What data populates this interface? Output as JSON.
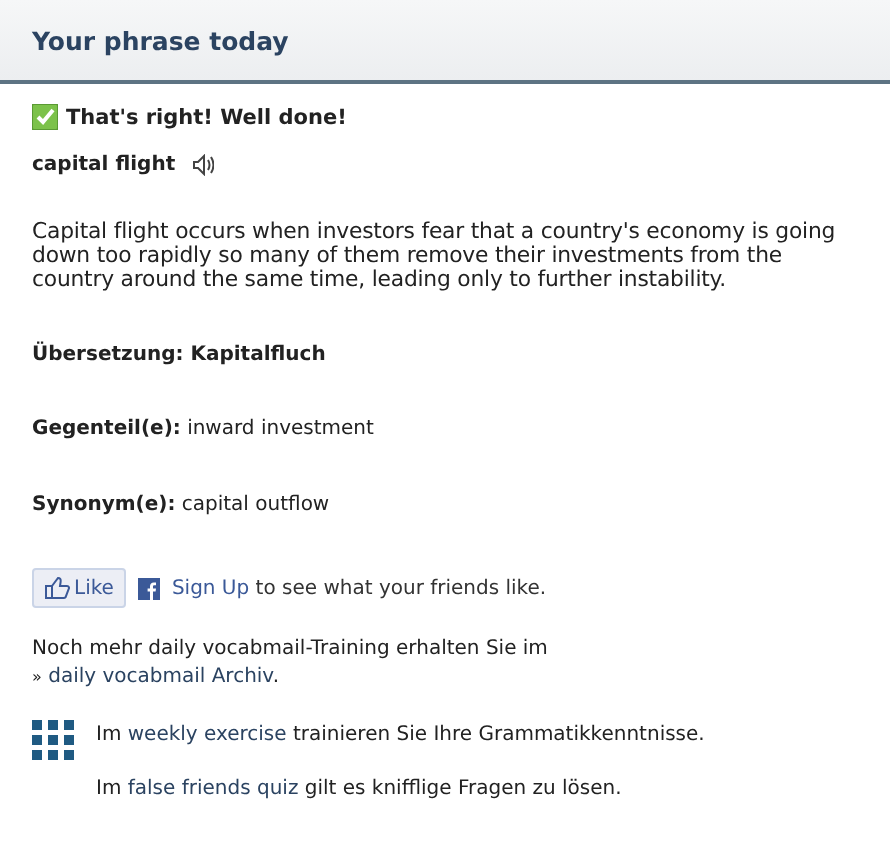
{
  "header": {
    "title": "Your phrase today"
  },
  "result": {
    "correct": true,
    "message": "That's right! Well done!"
  },
  "phrase": {
    "term": "capital flight"
  },
  "definition": "Capital flight occurs when investors fear that a country's economy is going down too rapidly so many of them remove their investments from the country around the same time, leading only to further instability.",
  "translation": "Übersetzung: Kapitalfluch",
  "details": [
    "**Gegenteil(e):** inward investment",
    "**Synonym(e):** capital outflow"
  ],
  "social": {
    "like_label": "Like",
    "signup_link": "Sign Up",
    "signup_text": "to see what your friends like."
  },
  "archive": {
    "text": "Noch mehr daily vocabmail-Training erhalten Sie im",
    "marker": "»",
    "link": "daily vocabmail Archiv",
    "after": "."
  },
  "exercises": [
    {
      "before": "Im",
      "link": "weekly exercise",
      "after": "trainieren Sie Ihre Grammatikkenntnisse."
    },
    {
      "before": "Im",
      "link": "false friends quiz",
      "after": "gilt es knifflige Fragen zu lösen."
    }
  ]
}
